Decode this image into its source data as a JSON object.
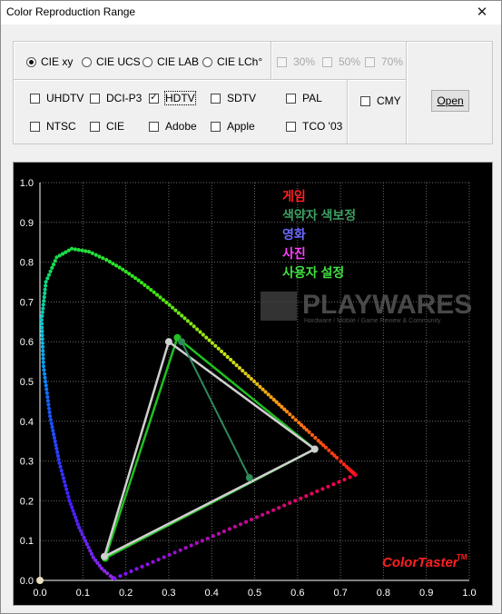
{
  "window": {
    "title": "Color Reproduction Range",
    "close_glyph": "✕"
  },
  "space_modes": [
    {
      "label": "CIE xy",
      "selected": true
    },
    {
      "label": "CIE UCS",
      "selected": false
    },
    {
      "label": "CIE LAB",
      "selected": false
    },
    {
      "label": "CIE LCh°",
      "selected": false
    }
  ],
  "percent_options": [
    {
      "label": "30%",
      "enabled": false
    },
    {
      "label": "50%",
      "enabled": false
    },
    {
      "label": "70%",
      "enabled": false
    }
  ],
  "standards_row1": [
    {
      "label": "UHDTV",
      "checked": false
    },
    {
      "label": "DCI-P3",
      "checked": false
    },
    {
      "label": "HDTV",
      "checked": true
    },
    {
      "label": "SDTV",
      "checked": false
    },
    {
      "label": "PAL",
      "checked": false
    }
  ],
  "standards_row2": [
    {
      "label": "NTSC",
      "checked": false
    },
    {
      "label": "CIE",
      "checked": false
    },
    {
      "label": "Adobe",
      "checked": false
    },
    {
      "label": "Apple",
      "checked": false
    },
    {
      "label": "TCO '03",
      "checked": false
    }
  ],
  "cmy": {
    "label": "CMY",
    "checked": false
  },
  "open_button": {
    "label": "Open"
  },
  "chart_data": {
    "type": "scatter",
    "xlim": [
      0.0,
      1.0
    ],
    "ylim": [
      0.0,
      1.0
    ],
    "xticks": [
      "0.0",
      "0.1",
      "0.2",
      "0.3",
      "0.4",
      "0.5",
      "0.6",
      "0.7",
      "0.8",
      "0.9",
      "1.0"
    ],
    "yticks": [
      "0.0",
      "0.1",
      "0.2",
      "0.3",
      "0.4",
      "0.5",
      "0.6",
      "0.7",
      "0.8",
      "0.9",
      "1.0"
    ],
    "grid": true,
    "legend_position": "top-center",
    "legend": [
      {
        "label": "게임",
        "color": "#ff2020"
      },
      {
        "label": "색약자 색보정",
        "color": "#3ca060"
      },
      {
        "label": "영화",
        "color": "#6a6aff"
      },
      {
        "label": "사진",
        "color": "#ff40ff"
      },
      {
        "label": "사용자 설정",
        "color": "#40e040"
      }
    ],
    "spectral_locus": [
      [
        0.1741,
        0.005
      ],
      [
        0.1738,
        0.0049
      ],
      [
        0.1733,
        0.0048
      ],
      [
        0.1726,
        0.0048
      ],
      [
        0.1714,
        0.0051
      ],
      [
        0.1689,
        0.0069
      ],
      [
        0.1644,
        0.0109
      ],
      [
        0.1566,
        0.0177
      ],
      [
        0.144,
        0.0297
      ],
      [
        0.1241,
        0.0578
      ],
      [
        0.0913,
        0.1327
      ],
      [
        0.0687,
        0.2007
      ],
      [
        0.0454,
        0.295
      ],
      [
        0.0235,
        0.4127
      ],
      [
        0.0082,
        0.5384
      ],
      [
        0.0039,
        0.6548
      ],
      [
        0.0139,
        0.7502
      ],
      [
        0.0389,
        0.812
      ],
      [
        0.0743,
        0.8338
      ],
      [
        0.1142,
        0.8262
      ],
      [
        0.1547,
        0.8059
      ],
      [
        0.1929,
        0.7816
      ],
      [
        0.2296,
        0.7543
      ],
      [
        0.2658,
        0.7243
      ],
      [
        0.3016,
        0.6923
      ],
      [
        0.3373,
        0.6589
      ],
      [
        0.3731,
        0.6245
      ],
      [
        0.4087,
        0.5896
      ],
      [
        0.4441,
        0.5547
      ],
      [
        0.4788,
        0.5202
      ],
      [
        0.5125,
        0.4866
      ],
      [
        0.5448,
        0.4544
      ],
      [
        0.5752,
        0.4242
      ],
      [
        0.6029,
        0.3965
      ],
      [
        0.627,
        0.3725
      ],
      [
        0.6482,
        0.3514
      ],
      [
        0.6658,
        0.334
      ],
      [
        0.6801,
        0.3197
      ],
      [
        0.6915,
        0.3083
      ],
      [
        0.7006,
        0.2993
      ],
      [
        0.7079,
        0.292
      ],
      [
        0.714,
        0.2859
      ],
      [
        0.719,
        0.2809
      ],
      [
        0.723,
        0.277
      ],
      [
        0.726,
        0.274
      ],
      [
        0.7283,
        0.2717
      ],
      [
        0.73,
        0.27
      ],
      [
        0.7311,
        0.2689
      ],
      [
        0.732,
        0.268
      ],
      [
        0.7327,
        0.2673
      ],
      [
        0.7334,
        0.2666
      ],
      [
        0.734,
        0.266
      ],
      [
        0.7344,
        0.2656
      ],
      [
        0.7346,
        0.2654
      ],
      [
        0.7347,
        0.2653
      ]
    ],
    "series": [
      {
        "name": "게임",
        "color": "#20c020",
        "points": [
          [
            0.64,
            0.33
          ],
          [
            0.32,
            0.61
          ],
          [
            0.152,
            0.056
          ]
        ]
      },
      {
        "name": "HDTV",
        "color": "#d0d0d0",
        "points": [
          [
            0.64,
            0.33
          ],
          [
            0.3,
            0.6
          ],
          [
            0.15,
            0.06
          ]
        ]
      },
      {
        "name": "색약자 색보정",
        "color": "#2e8b57",
        "points": [
          [
            0.33,
            0.6
          ],
          [
            0.488,
            0.258
          ]
        ]
      }
    ],
    "white_point": [
      0.0,
      0.0
    ],
    "watermark": "PLAYWARES",
    "watermark_sub": "Hardware / Mobile / Game Review & Community",
    "brand": "ColorTaster",
    "brand_tm": "TM"
  }
}
